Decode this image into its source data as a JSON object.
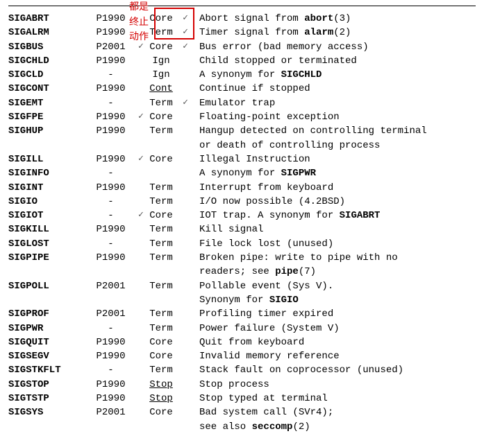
{
  "annotations": {
    "line1": "都是",
    "line2": "终止",
    "line3": "动作"
  },
  "rows": [
    {
      "sig": "SIGABRT",
      "std": "P1990",
      "act": "Core",
      "tick_after": true,
      "desc_pre": "Abort signal from ",
      "desc_bold": "abort",
      "desc_post": "(3)"
    },
    {
      "sig": "SIGALRM",
      "std": "P1990",
      "act": "Term",
      "tick_after": true,
      "desc_pre": "Timer signal from ",
      "desc_bold": "alarm",
      "desc_post": "(2)"
    },
    {
      "sig": "SIGBUS",
      "std": "P2001",
      "act": "Core",
      "tick_before": true,
      "tick_after": true,
      "desc_pre": "Bus error (bad memory access)"
    },
    {
      "sig": "SIGCHLD",
      "std": "P1990",
      "act": "Ign",
      "desc_pre": "Child stopped or terminated"
    },
    {
      "sig": "SIGCLD",
      "std": "-",
      "act": "Ign",
      "desc_pre": "A synonym for ",
      "desc_bold": "SIGCHLD"
    },
    {
      "sig": "SIGCONT",
      "std": "P1990",
      "act": "Cont",
      "underline": true,
      "desc_pre": "Continue if stopped"
    },
    {
      "sig": "SIGEMT",
      "std": "-",
      "act": "Term",
      "tick_after": true,
      "desc_pre": "Emulator trap"
    },
    {
      "sig": "SIGFPE",
      "std": "P1990",
      "act": "Core",
      "tick_before": true,
      "desc_pre": "Floating-point exception"
    },
    {
      "sig": "SIGHUP",
      "std": "P1990",
      "act": "Term",
      "desc_pre": "Hangup detected on controlling terminal",
      "desc2": "or death of controlling process"
    },
    {
      "sig": "SIGILL",
      "std": "P1990",
      "act": "Core",
      "tick_before": true,
      "desc_pre": "Illegal Instruction"
    },
    {
      "sig": "SIGINFO",
      "std": "-",
      "act": "",
      "desc_pre": "A synonym for ",
      "desc_bold": "SIGPWR"
    },
    {
      "sig": "SIGINT",
      "std": "P1990",
      "act": "Term",
      "desc_pre": "Interrupt from keyboard"
    },
    {
      "sig": "SIGIO",
      "std": "-",
      "act": "Term",
      "desc_pre": "I/O now possible (4.2BSD)"
    },
    {
      "sig": "SIGIOT",
      "std": "-",
      "act": "Core",
      "tick_before": true,
      "desc_pre": "IOT trap. A synonym for ",
      "desc_bold": "SIGABRT"
    },
    {
      "sig": "SIGKILL",
      "std": "P1990",
      "act": "Term",
      "desc_pre": "Kill signal"
    },
    {
      "sig": "SIGLOST",
      "std": "-",
      "act": "Term",
      "desc_pre": "File lock lost (unused)"
    },
    {
      "sig": "SIGPIPE",
      "std": "P1990",
      "act": "Term",
      "desc_pre": "Broken pipe: write to pipe with no",
      "desc2_pre": "readers; see ",
      "desc2_bold": "pipe",
      "desc2_post": "(7)"
    },
    {
      "sig": "SIGPOLL",
      "std": "P2001",
      "act": "Term",
      "desc_pre": "Pollable event (Sys V).",
      "desc2_pre": "Synonym for ",
      "desc2_bold": "SIGIO"
    },
    {
      "sig": "SIGPROF",
      "std": "P2001",
      "act": "Term",
      "desc_pre": "Profiling timer expired"
    },
    {
      "sig": "SIGPWR",
      "std": "-",
      "act": "Term",
      "desc_pre": "Power failure (System V)"
    },
    {
      "sig": "SIGQUIT",
      "std": "P1990",
      "act": "Core",
      "desc_pre": "Quit from keyboard"
    },
    {
      "sig": "SIGSEGV",
      "std": "P1990",
      "act": "Core",
      "desc_pre": "Invalid memory reference"
    },
    {
      "sig": "SIGSTKFLT",
      "std": "-",
      "act": "Term",
      "desc_pre": "Stack fault on coprocessor (unused)"
    },
    {
      "sig": "SIGSTOP",
      "std": "P1990",
      "act": "Stop",
      "underline": true,
      "desc_pre": "Stop process"
    },
    {
      "sig": "SIGTSTP",
      "std": "P1990",
      "act": "Stop",
      "underline": true,
      "desc_pre": "Stop typed at terminal"
    },
    {
      "sig": "SIGSYS",
      "std": "P2001",
      "act": "Core",
      "desc_pre": "Bad system call (SVr4);",
      "desc2_pre": "see also ",
      "desc2_bold": "seccomp",
      "desc2_post": "(2)"
    }
  ]
}
